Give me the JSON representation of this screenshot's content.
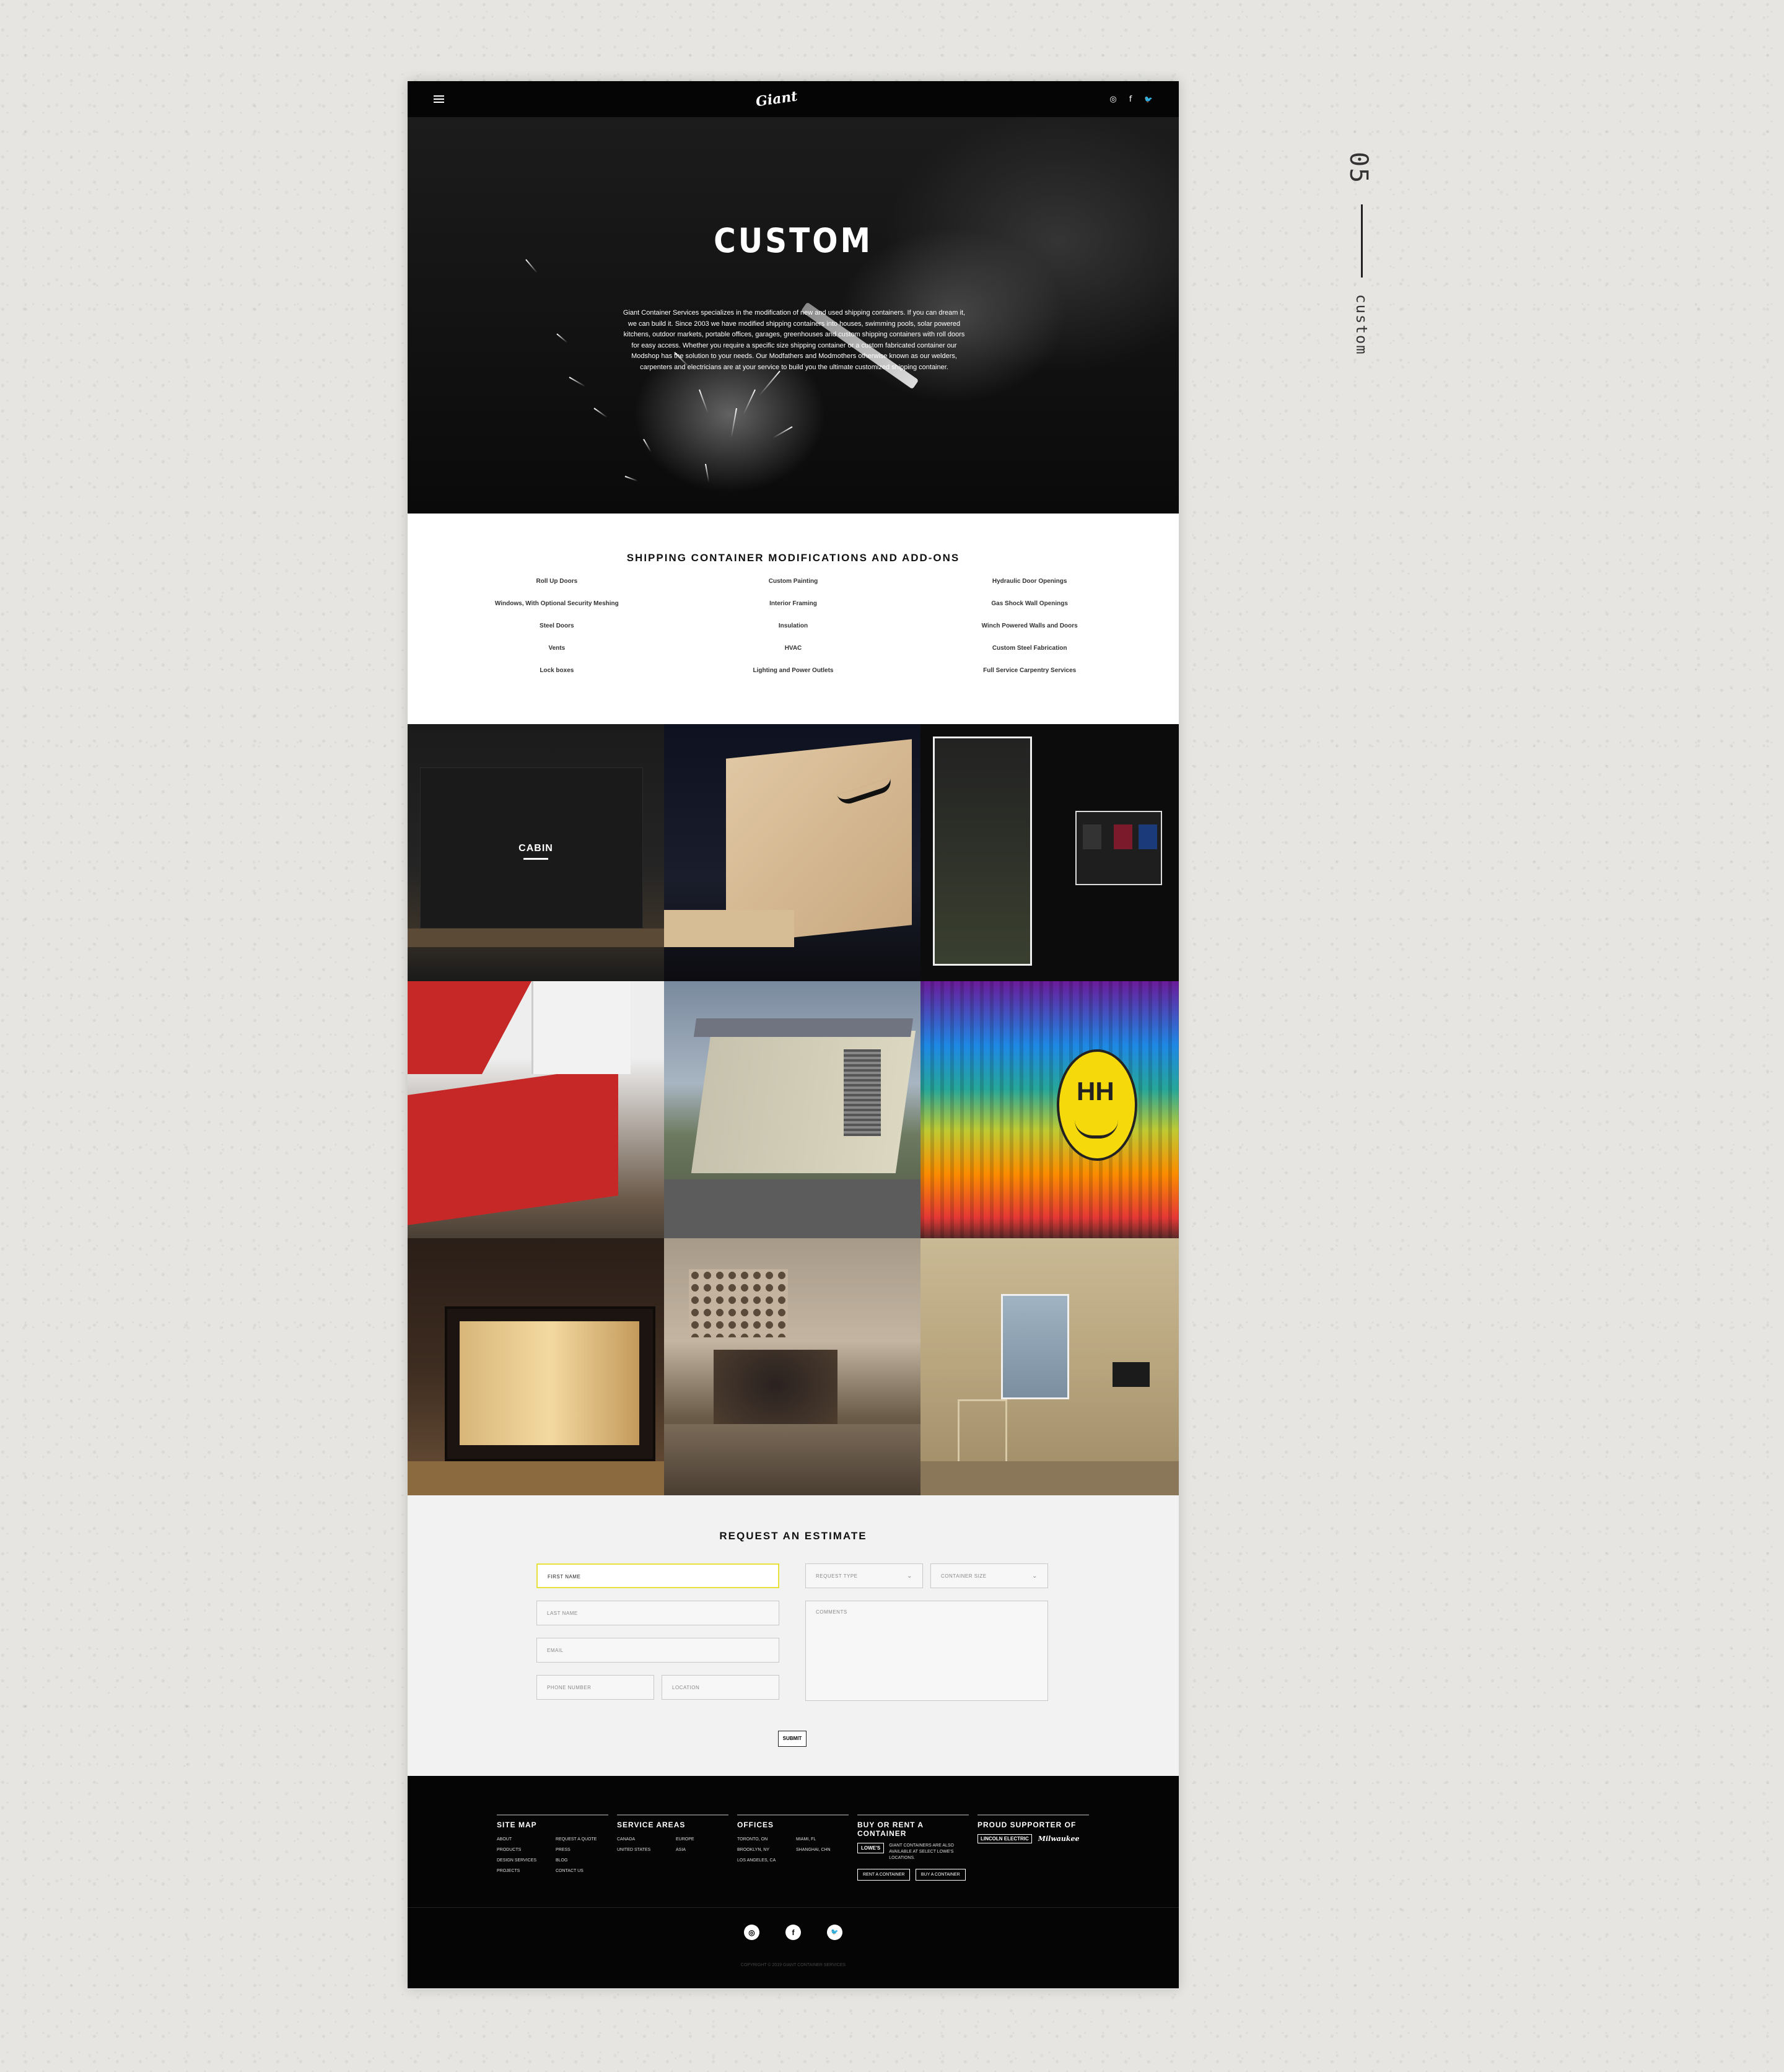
{
  "side": {
    "number": "05",
    "label": "custom"
  },
  "topbar": {
    "logo": "Giant",
    "icons": [
      "instagram-icon",
      "facebook-icon",
      "twitter-icon"
    ],
    "instagram": "◎",
    "facebook": "f",
    "twitter": "🐦"
  },
  "hero": {
    "title": "CUSTOM",
    "text": "Giant Container Services specializes in the modification of new and used shipping containers. If you can dream it, we can build it. Since 2003 we have modified shipping containers into houses, swimming pools, solar powered kitchens, outdoor markets, portable offices, garages, greenhouses and custom shipping containers with roll doors for easy access. Whether you require a specific size shipping container or a custom fabricated container our Modshop has the solution to your needs. Our Modfathers and Modmothers otherwise known as our welders, carpenters and electricians are at your service to build you the ultimate customized shipping container."
  },
  "mods": {
    "title": "SHIPPING CONTAINER MODIFICATIONS AND ADD-ONS",
    "col1": [
      "Roll Up Doors",
      "Windows, With Optional Security Meshing",
      "Steel Doors",
      "Vents",
      "Lock boxes"
    ],
    "col2": [
      "Custom Painting",
      "Interior Framing",
      "Insulation",
      "HVAC",
      "Lighting and Power Outlets"
    ],
    "col3": [
      "Hydraulic Door Openings",
      "Gas Shock Wall Openings",
      "Winch Powered Walls and Doors",
      "Custom Steel Fabrication",
      "Full Service Carpentry Services"
    ]
  },
  "gallery": {
    "cabin_label": "CABIN"
  },
  "estimate": {
    "title": "REQUEST AN ESTIMATE",
    "first_name": "FIRST NAME",
    "last_name": "LAST NAME",
    "email": "EMAIL",
    "phone": "PHONE NUMBER",
    "location": "LOCATION",
    "request_type": "REQUEST TYPE",
    "container_size": "CONTAINER SIZE",
    "comments": "COMMENTS",
    "submit": "SUBMIT"
  },
  "footer": {
    "sitemap": {
      "title": "SITE MAP",
      "links": [
        "ABOUT",
        "REQUEST A QUOTE",
        "PRODUCTS",
        "PRESS",
        "DESIGN SERVICES",
        "BLOG",
        "PROJECTS",
        "CONTACT US"
      ]
    },
    "service": {
      "title": "SERVICE AREAS",
      "links": [
        "CANADA",
        "EUROPE",
        "UNITED STATES",
        "ASIA"
      ]
    },
    "offices": {
      "title": "OFFICES",
      "links": [
        "TORONTO, ON",
        "MIAMI, FL",
        "BROOKLYN, NY",
        "SHANGHAI, CHN",
        "LOS ANGELES, CA",
        ""
      ]
    },
    "buy": {
      "title": "BUY OR RENT A CONTAINER",
      "lowes": "LOWE'S",
      "note": "GIANT CONTAINERS ARE ALSO AVAILABLE AT SELECT LOWE'S LOCATIONS.",
      "rent": "RENT A CONTAINER",
      "buy_btn": "BUY A CONTAINER"
    },
    "proud": {
      "title": "PROUD SUPPORTER OF",
      "brand1": "LINCOLN ELECTRIC",
      "brand2": "Milwaukee"
    },
    "copyright": "COPYRIGHT © 2019 GIANT CONTAINER SERVICES"
  }
}
